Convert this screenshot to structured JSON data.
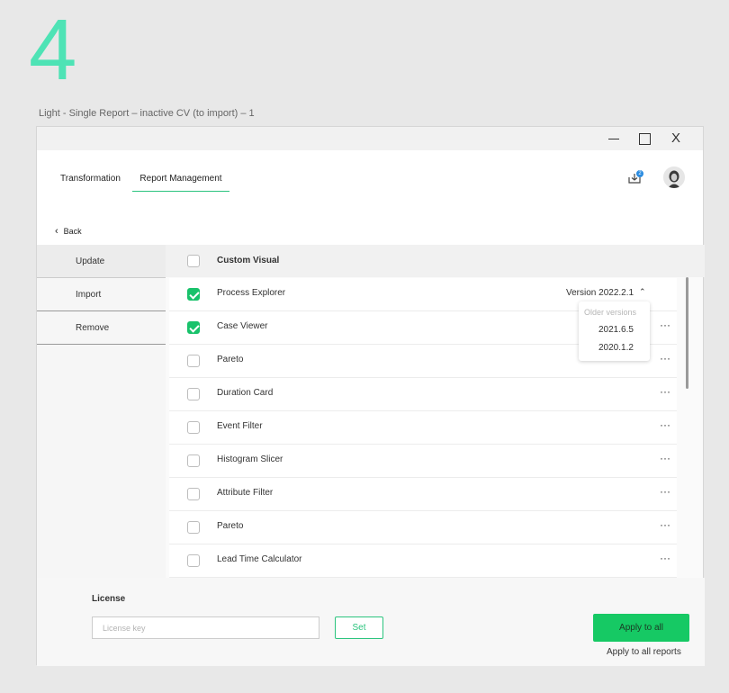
{
  "frame": {
    "number": "4",
    "caption": "Light - Single Report – inactive CV (to import) – 1"
  },
  "window": {
    "minimize_icon": "minimize-icon",
    "maximize_icon": "maximize-icon",
    "close_label": "X"
  },
  "nav": {
    "tabs": [
      {
        "label": "Transformation",
        "active": false
      },
      {
        "label": "Report Management",
        "active": true
      }
    ],
    "download_badge": "2",
    "back_label": "Back",
    "accent": "#2bc47e"
  },
  "sidebar": {
    "items": [
      {
        "label": "Update",
        "active": true
      },
      {
        "label": "Import",
        "active": false
      },
      {
        "label": "Remove",
        "active": false
      }
    ]
  },
  "table": {
    "header": "Custom Visual",
    "rows": [
      {
        "label": "Process Explorer",
        "checked": true,
        "version": "Version 2022.2.1"
      },
      {
        "label": "Case Viewer",
        "checked": true
      },
      {
        "label": "Pareto",
        "checked": false
      },
      {
        "label": "Duration Card",
        "checked": false
      },
      {
        "label": "Event Filter",
        "checked": false
      },
      {
        "label": "Histogram Slicer",
        "checked": false
      },
      {
        "label": "Attribute Filter",
        "checked": false
      },
      {
        "label": "Pareto",
        "checked": false
      },
      {
        "label": "Lead Time Calculator",
        "checked": false
      }
    ],
    "more_label": "···",
    "dropdown": {
      "header": "Older versions",
      "options": [
        "2021.6.5",
        "2020.1.2"
      ]
    }
  },
  "footer": {
    "license_label": "License",
    "license_placeholder": "License key",
    "set_label": "Set",
    "apply_label": "Apply to all",
    "apply_reports_label": "Apply to all reports",
    "apply_color": "#16c964"
  }
}
